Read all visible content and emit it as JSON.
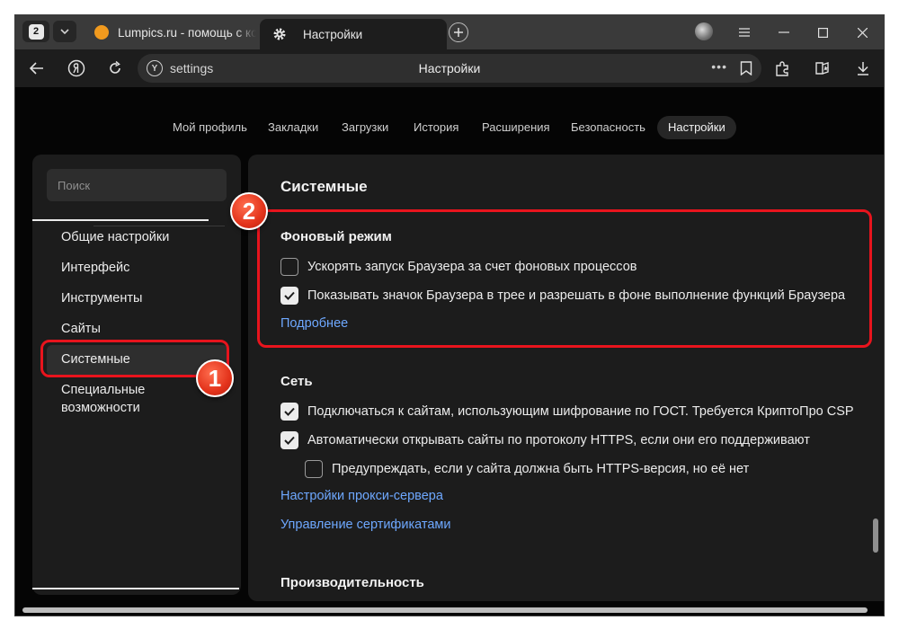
{
  "browser": {
    "tab_count": "2",
    "tabs": [
      {
        "title": "Lumpics.ru - помощь с компьютером"
      },
      {
        "title": "Настройки"
      }
    ],
    "address": {
      "url": "settings",
      "page_title": "Настройки",
      "more": "•••"
    }
  },
  "settings_nav": {
    "items": [
      "Мой профиль",
      "Закладки",
      "Загрузки",
      "История",
      "Расширения",
      "Безопасность",
      "Настройки"
    ],
    "active": "Настройки"
  },
  "sidebar": {
    "search_placeholder": "Поиск",
    "items": [
      "Общие настройки",
      "Интерфейс",
      "Инструменты",
      "Сайты",
      "Системные",
      "Специальные возможности"
    ],
    "active": "Системные"
  },
  "content": {
    "title": "Системные",
    "background": {
      "heading": "Фоновый режим",
      "options": [
        {
          "label": "Ускорять запуск Браузера за счет фоновых процессов",
          "checked": false
        },
        {
          "label": "Показывать значок Браузера в трее и разрешать в фоне выполнение функций Браузера",
          "checked": true
        }
      ],
      "link": "Подробнее"
    },
    "network": {
      "heading": "Сеть",
      "options": [
        {
          "label": "Подключаться к сайтам, использующим шифрование по ГОСТ. Требуется КриптоПро CSP",
          "checked": true
        },
        {
          "label": "Автоматически открывать сайты по протоколу HTTPS, если они его поддерживают",
          "checked": true
        },
        {
          "label": "Предупреждать, если у сайта должна быть HTTPS-версия, но её нет",
          "checked": false
        }
      ],
      "links": [
        "Настройки прокси-сервера",
        "Управление сертификатами"
      ]
    },
    "performance": {
      "heading": "Производительность"
    }
  },
  "annotations": {
    "badge_1": "1",
    "badge_2": "2",
    "highlight_color": "#e8141d"
  },
  "colors": {
    "link": "#6ea8ff",
    "background": "#050505",
    "panel": "#1c1c1c"
  }
}
